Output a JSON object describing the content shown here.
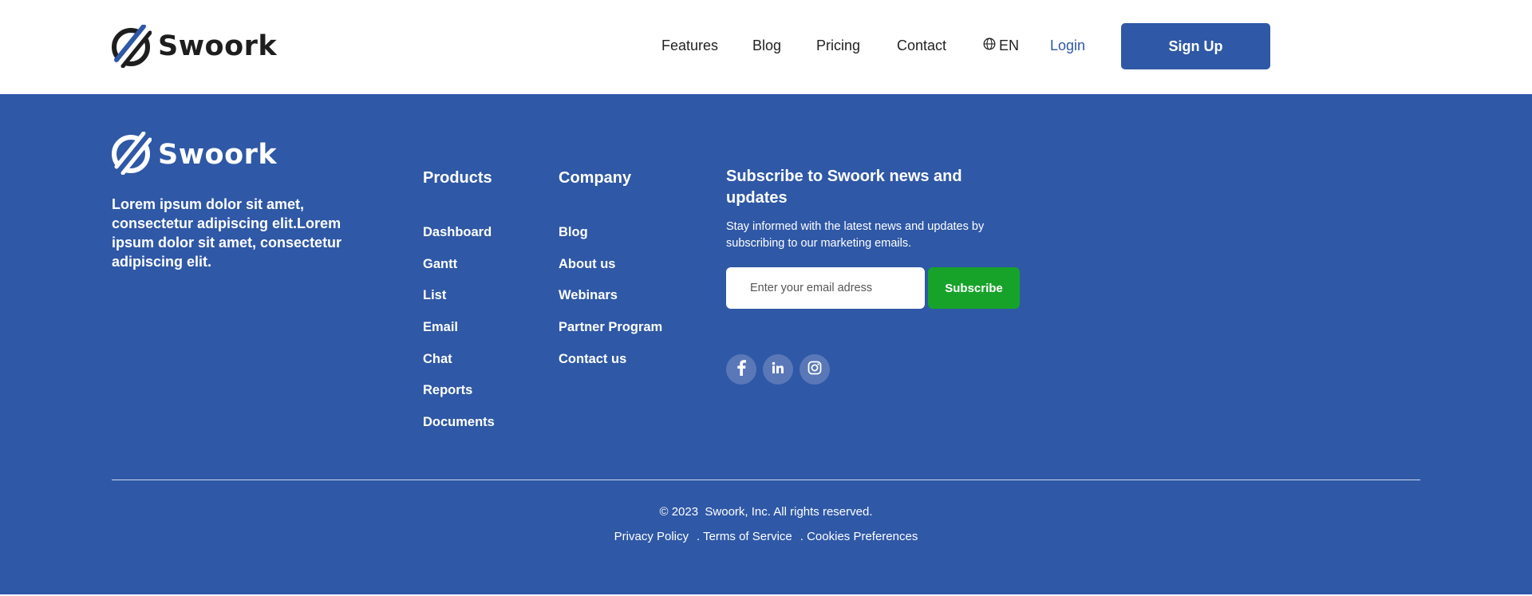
{
  "header": {
    "brand_name": "Swoork",
    "nav": {
      "features": "Features",
      "blog": "Blog",
      "pricing": "Pricing",
      "contact": "Contact",
      "language": "EN",
      "login": "Login"
    },
    "signup_label": "Sign Up",
    "icons": [
      "brand-logo-icon",
      "globe-icon"
    ]
  },
  "footer": {
    "brand_name": "Swoork",
    "about": "Lorem ipsum dolor sit amet, consectetur adipiscing elit.Lorem ipsum dolor sit amet, consectetur adipiscing elit.",
    "products": {
      "title": "Products",
      "items": [
        "Dashboard",
        "Gantt",
        "List",
        "Email",
        "Chat",
        "Reports",
        "Documents"
      ]
    },
    "company": {
      "title": "Company",
      "items": [
        "Blog",
        "About us",
        "Webinars",
        "Partner Program",
        "Contact us"
      ]
    },
    "subscribe": {
      "title": "Subscribe to Swoork news and updates",
      "description": "Stay informed with the latest news and updates by subscribing to our marketing emails.",
      "email_placeholder": "Enter your email adress",
      "email_value": "",
      "button_label": "Subscribe"
    },
    "social": [
      "facebook-icon",
      "linkedin-icon",
      "instagram-icon"
    ],
    "copyright": "© 2023  Swoork, Inc. All rights reserved.",
    "legal": {
      "privacy": "Privacy Policy",
      "terms": ". Terms of Service",
      "cookies": ". Cookies Preferences"
    }
  },
  "colors": {
    "primary": "#2f58a6",
    "subscribe_green": "#17a32a",
    "text_dark": "#222222",
    "social_circle": "#5a78b8"
  }
}
